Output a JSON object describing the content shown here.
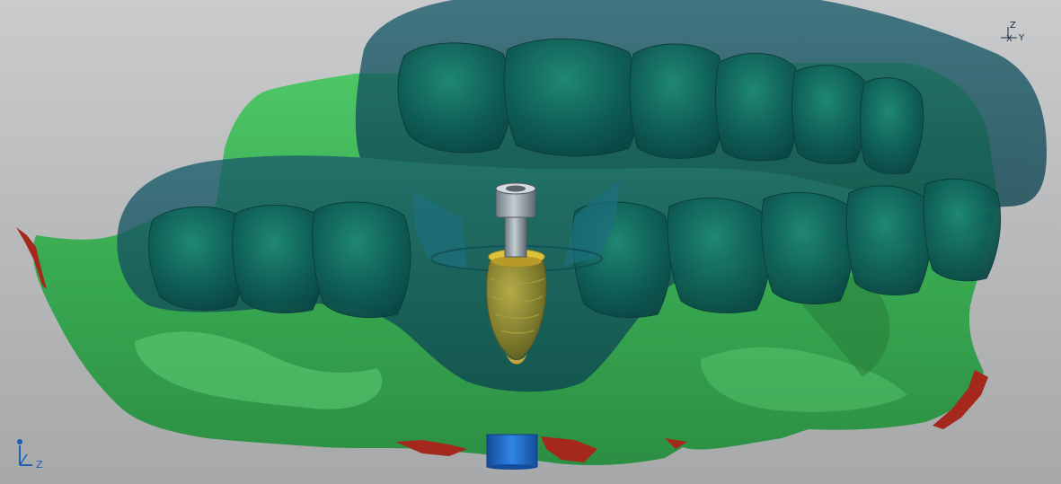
{
  "viewport": {
    "background_top": "#c9cbcc",
    "background_bottom": "#a6a8aa"
  },
  "scene": {
    "models": [
      {
        "name": "lower-jaw-scan",
        "color": "#3fb55a"
      },
      {
        "name": "surgical-guide",
        "color": "#0f4f5e",
        "opacity": 0.72
      },
      {
        "name": "upper-teeth",
        "color": "#0e5a56"
      },
      {
        "name": "implant-body",
        "color": "#8a8a2e"
      },
      {
        "name": "implant-abutment",
        "color": "#8f9aa2"
      },
      {
        "name": "implant-collar",
        "color": "#e0c23a"
      },
      {
        "name": "analog-cylinder",
        "color": "#1f6fd0"
      },
      {
        "name": "deviation-areas",
        "color": "#a5281c"
      }
    ]
  },
  "triad_top_right": {
    "z_label": "Z",
    "x_label": "X",
    "y_label": "Y",
    "icon": "axis-triad-icon"
  },
  "triad_bottom_left": {
    "z_label": "Z",
    "icon": "axis-triad-icon",
    "color": "#1f5fb5"
  }
}
